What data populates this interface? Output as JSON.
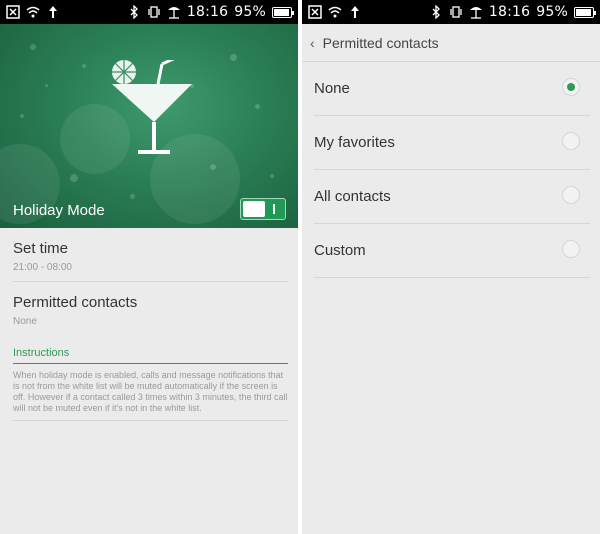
{
  "status": {
    "time": "18:16",
    "battery": "95%"
  },
  "left": {
    "hero_title": "Holiday Mode",
    "toggle_on": true,
    "set_time": {
      "title": "Set time",
      "value": "21:00 - 08:00"
    },
    "permitted": {
      "title": "Permitted contacts",
      "value": "None"
    },
    "instructions": {
      "heading": "Instructions",
      "text": "When holiday mode is enabled, calls and message notifications that is not from the white list will be muted automatically if the screen is off. However if a contact called 3 times within 3 minutes, the third call will not be muted even if it's not in the white list."
    }
  },
  "right": {
    "title": "Permitted contacts",
    "options": [
      {
        "label": "None",
        "selected": true
      },
      {
        "label": "My favorites",
        "selected": false
      },
      {
        "label": "All contacts",
        "selected": false
      },
      {
        "label": "Custom",
        "selected": false
      }
    ]
  },
  "colors": {
    "accent": "#2f9a55",
    "hero": "#2a7e55"
  }
}
